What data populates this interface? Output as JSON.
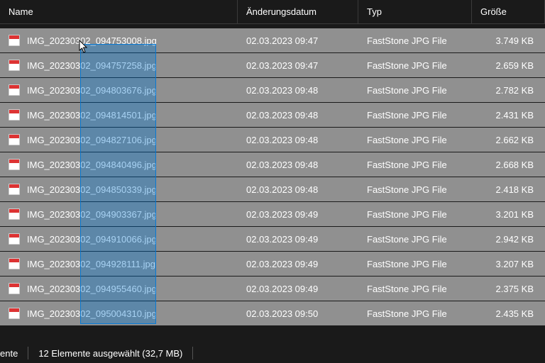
{
  "columns": {
    "name": "Name",
    "date": "Änderungsdatum",
    "type": "Typ",
    "size": "Größe"
  },
  "rows": [
    {
      "name": "IMG_20230302_094753008.jpg",
      "date": "02.03.2023 09:47",
      "type": "FastStone JPG File",
      "size": "3.749 KB",
      "selected": true
    },
    {
      "name": "IMG_20230302_094757258.jpg",
      "date": "02.03.2023 09:47",
      "type": "FastStone JPG File",
      "size": "2.659 KB",
      "selected": true
    },
    {
      "name": "IMG_20230302_094803676.jpg",
      "date": "02.03.2023 09:48",
      "type": "FastStone JPG File",
      "size": "2.782 KB",
      "selected": true
    },
    {
      "name": "IMG_20230302_094814501.jpg",
      "date": "02.03.2023 09:48",
      "type": "FastStone JPG File",
      "size": "2.431 KB",
      "selected": true
    },
    {
      "name": "IMG_20230302_094827106.jpg",
      "date": "02.03.2023 09:48",
      "type": "FastStone JPG File",
      "size": "2.662 KB",
      "selected": true
    },
    {
      "name": "IMG_20230302_094840496.jpg",
      "date": "02.03.2023 09:48",
      "type": "FastStone JPG File",
      "size": "2.668 KB",
      "selected": true
    },
    {
      "name": "IMG_20230302_094850339.jpg",
      "date": "02.03.2023 09:48",
      "type": "FastStone JPG File",
      "size": "2.418 KB",
      "selected": true
    },
    {
      "name": "IMG_20230302_094903367.jpg",
      "date": "02.03.2023 09:49",
      "type": "FastStone JPG File",
      "size": "3.201 KB",
      "selected": true
    },
    {
      "name": "IMG_20230302_094910066.jpg",
      "date": "02.03.2023 09:49",
      "type": "FastStone JPG File",
      "size": "2.942 KB",
      "selected": true
    },
    {
      "name": "IMG_20230302_094928111.jpg",
      "date": "02.03.2023 09:49",
      "type": "FastStone JPG File",
      "size": "3.207 KB",
      "selected": true
    },
    {
      "name": "IMG_20230302_094955460.jpg",
      "date": "02.03.2023 09:49",
      "type": "FastStone JPG File",
      "size": "2.375 KB",
      "selected": true
    },
    {
      "name": "IMG_20230302_095004310.jpg",
      "date": "02.03.2023 09:50",
      "type": "FastStone JPG File",
      "size": "2.435 KB",
      "selected": true
    }
  ],
  "status": {
    "left": "ente",
    "selection": "12 Elemente ausgewählt (32,7 MB)"
  }
}
